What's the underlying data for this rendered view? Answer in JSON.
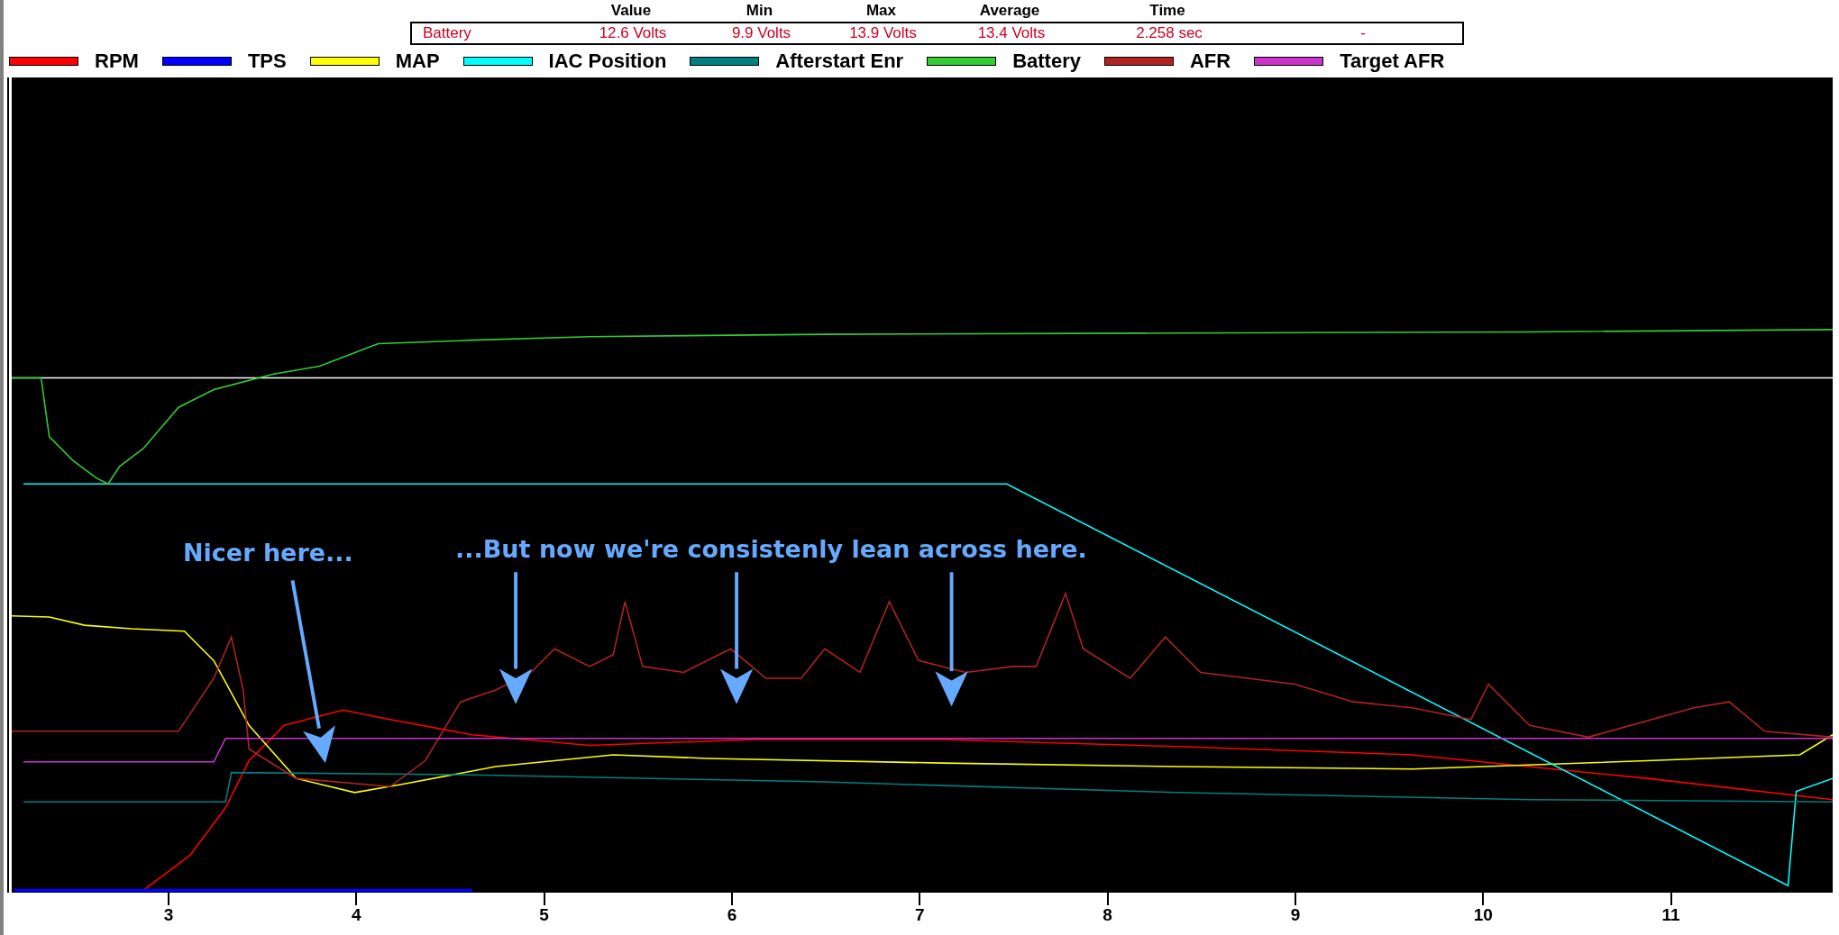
{
  "readout": {
    "columns": [
      "Value",
      "Min",
      "Max",
      "Average",
      "Time"
    ],
    "row": {
      "channel": "Battery",
      "cells": [
        "12.6 Volts",
        "9.9 Volts",
        "13.9 Volts",
        "13.4 Volts",
        "2.258 sec",
        "-"
      ]
    }
  },
  "legend": [
    {
      "label": "RPM",
      "color": "#ff0000"
    },
    {
      "label": "TPS",
      "color": "#0000ff"
    },
    {
      "label": "MAP",
      "color": "#ffff00"
    },
    {
      "label": "IAC Position",
      "color": "#00ffff"
    },
    {
      "label": "Afterstart Enr",
      "color": "#008080"
    },
    {
      "label": "Battery",
      "color": "#33cc33"
    },
    {
      "label": "AFR",
      "color": "#b22222"
    },
    {
      "label": "Target AFR",
      "color": "#cc33cc"
    }
  ],
  "annotations": [
    {
      "text": "Nicer here..."
    },
    {
      "text": "...But now we're consistenly lean across here."
    }
  ],
  "x_axis": {
    "ticks": [
      "3",
      "4",
      "5",
      "6",
      "7",
      "8",
      "9",
      "10",
      "11"
    ]
  }
}
